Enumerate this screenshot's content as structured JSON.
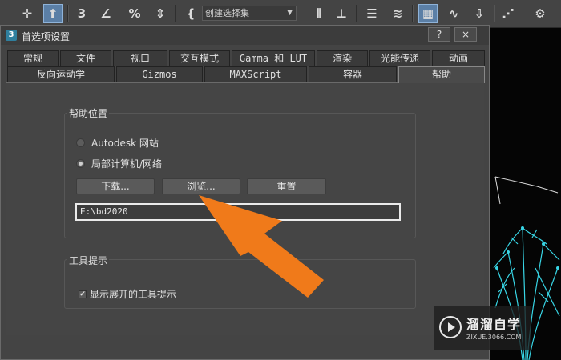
{
  "toolbar": {
    "selection_set_placeholder": "创建选择集",
    "icons": [
      "move-icon",
      "select-icon",
      "snap-3d-icon",
      "angle-snap-icon",
      "percent-snap-icon",
      "spinner-snap-icon",
      "named-selection-icon",
      "mirror-icon",
      "align-icon",
      "scene-explorer-icon",
      "layer-explorer-icon",
      "toggle-ribbon-icon",
      "curve-editor-icon",
      "schematic-view-icon",
      "material-editor-icon",
      "render-setup-icon"
    ]
  },
  "dialog": {
    "title": "首选项设置",
    "app_icon_text": "3",
    "help_btn": "?",
    "close_btn": "×",
    "tabs_row1": [
      "常规",
      "文件",
      "视口",
      "交互模式",
      "Gamma 和 LUT",
      "渲染",
      "光能传递",
      "动画"
    ],
    "tabs_row2": [
      "反向运动学",
      "Gizmos",
      "MAXScript",
      "容器",
      "帮助"
    ],
    "selected_tab": "帮助"
  },
  "help_location": {
    "group_label": "帮助位置",
    "option_web": "Autodesk 网站",
    "option_local": "局部计算机/网络",
    "selected_option": "局部计算机/网络",
    "download_btn": "下载...",
    "browse_btn": "浏览...",
    "reset_btn": "重置",
    "path_value": "E:\\bd2020"
  },
  "tooltips": {
    "group_label": "工具提示",
    "show_expanded_label": "显示展开的工具提示",
    "show_expanded_checked": true
  },
  "watermark": {
    "title": "溜溜自学",
    "subtitle": "ZIXUE.3066.COM"
  },
  "colors": {
    "arrow": "#f07a1a",
    "selection_active": "#5b7fa6",
    "viewport_wire": "#38d6e6"
  }
}
